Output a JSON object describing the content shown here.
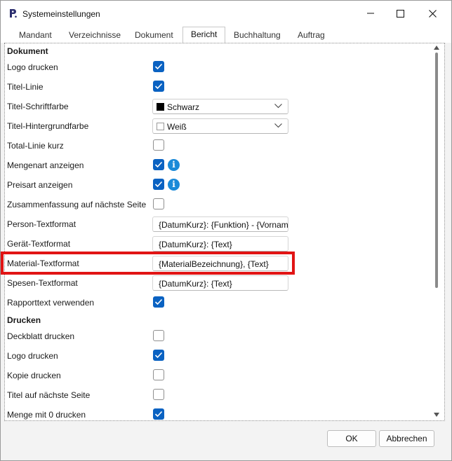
{
  "window": {
    "title": "Systemeinstellungen"
  },
  "tabs": [
    "Mandant",
    "Verzeichnisse",
    "Dokument",
    "Bericht",
    "Buchhaltung",
    "Auftrag"
  ],
  "active_tab": "Bericht",
  "sections": {
    "dokument": "Dokument",
    "drucken": "Drucken"
  },
  "settings": {
    "logo_drucken": {
      "label": "Logo drucken",
      "checked": true
    },
    "titel_linie": {
      "label": "Titel-Linie",
      "checked": true
    },
    "titel_schriftfarbe": {
      "label": "Titel-Schriftfarbe",
      "value": "Schwarz",
      "color": "#000000"
    },
    "titel_hintergrundfarbe": {
      "label": "Titel-Hintergrundfarbe",
      "value": "Weiß",
      "color": "#ffffff"
    },
    "total_linie_kurz": {
      "label": "Total-Linie kurz",
      "checked": false
    },
    "mengenart_anzeigen": {
      "label": "Mengenart anzeigen",
      "checked": true,
      "icon": "info-icon"
    },
    "preisart_anzeigen": {
      "label": "Preisart anzeigen",
      "checked": true,
      "icon": "info-icon"
    },
    "zusammenfassung": {
      "label": "Zusammenfassung auf nächste Seite",
      "checked": false
    },
    "person_textformat": {
      "label": "Person-Textformat",
      "value": "{DatumKurz}: {Funktion} - {Vornam"
    },
    "geraet_textformat": {
      "label": "Gerät-Textformat",
      "value": "{DatumKurz}: {Text}"
    },
    "material_textformat": {
      "label": "Material-Textformat",
      "value": "{MaterialBezeichnung}, {Text}"
    },
    "spesen_textformat": {
      "label": "Spesen-Textformat",
      "value": "{DatumKurz}: {Text}"
    },
    "rapporttext_verwenden": {
      "label": "Rapporttext verwenden",
      "checked": true
    },
    "deckblatt_drucken": {
      "label": "Deckblatt drucken",
      "checked": false
    },
    "logo_drucken_2": {
      "label": "Logo drucken",
      "checked": true
    },
    "kopie_drucken": {
      "label": "Kopie drucken",
      "checked": false
    },
    "titel_naechste_seite": {
      "label": "Titel auf nächste Seite",
      "checked": false
    },
    "menge_mit_0": {
      "label": "Menge mit 0 drucken",
      "checked": true
    }
  },
  "buttons": {
    "ok": "OK",
    "cancel": "Abbrechen"
  },
  "colors": {
    "accent": "#0a62c2",
    "highlight": "#e11414",
    "info": "#1b8ad8"
  }
}
